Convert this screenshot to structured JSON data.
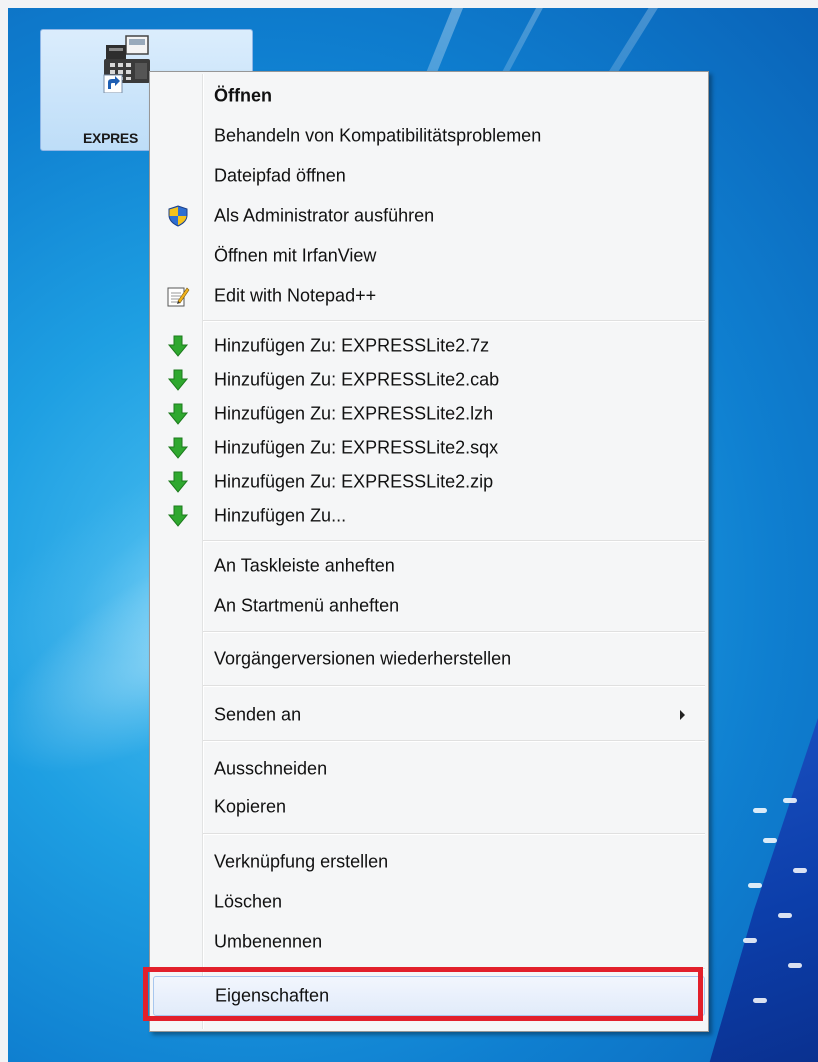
{
  "desktop": {
    "icon_label": "EXPRES",
    "icon_name": "fax-machine-shortcut-icon"
  },
  "menu": {
    "items": [
      {
        "label": "Öffnen",
        "bold": true,
        "icon": ""
      },
      {
        "label": "Behandeln von Kompatibilitätsproblemen",
        "icon": ""
      },
      {
        "label": "Dateipfad öffnen",
        "icon": ""
      },
      {
        "label": "Als Administrator ausführen",
        "icon": "uac-shield-icon"
      },
      {
        "label": "Öffnen mit IrfanView",
        "icon": ""
      },
      {
        "label": "Edit with Notepad++",
        "icon": "notepad-plus-icon"
      },
      {
        "label": "Hinzufügen Zu: EXPRESSLite2.7z",
        "icon": "green-down-arrow-icon"
      },
      {
        "label": "Hinzufügen Zu: EXPRESSLite2.cab",
        "icon": "green-down-arrow-icon"
      },
      {
        "label": "Hinzufügen Zu: EXPRESSLite2.lzh",
        "icon": "green-down-arrow-icon"
      },
      {
        "label": "Hinzufügen Zu: EXPRESSLite2.sqx",
        "icon": "green-down-arrow-icon"
      },
      {
        "label": "Hinzufügen Zu: EXPRESSLite2.zip",
        "icon": "green-down-arrow-icon"
      },
      {
        "label": "Hinzufügen Zu...",
        "icon": "green-down-arrow-icon"
      },
      {
        "label": "An Taskleiste anheften",
        "icon": ""
      },
      {
        "label": "An Startmenü anheften",
        "icon": ""
      },
      {
        "label": "Vorgängerversionen wiederherstellen",
        "icon": ""
      },
      {
        "label": "Senden an",
        "icon": "",
        "submenu": true
      },
      {
        "label": "Ausschneiden",
        "icon": ""
      },
      {
        "label": "Kopieren",
        "icon": ""
      },
      {
        "label": "Verknüpfung erstellen",
        "icon": ""
      },
      {
        "label": "Löschen",
        "icon": ""
      },
      {
        "label": "Umbenennen",
        "icon": ""
      },
      {
        "label": "Eigenschaften",
        "icon": "",
        "highlighted": true
      }
    ]
  },
  "colors": {
    "highlight_border": "#e2202b",
    "menu_background": "#f5f6f7",
    "arrow_green": "#2fa82f"
  }
}
